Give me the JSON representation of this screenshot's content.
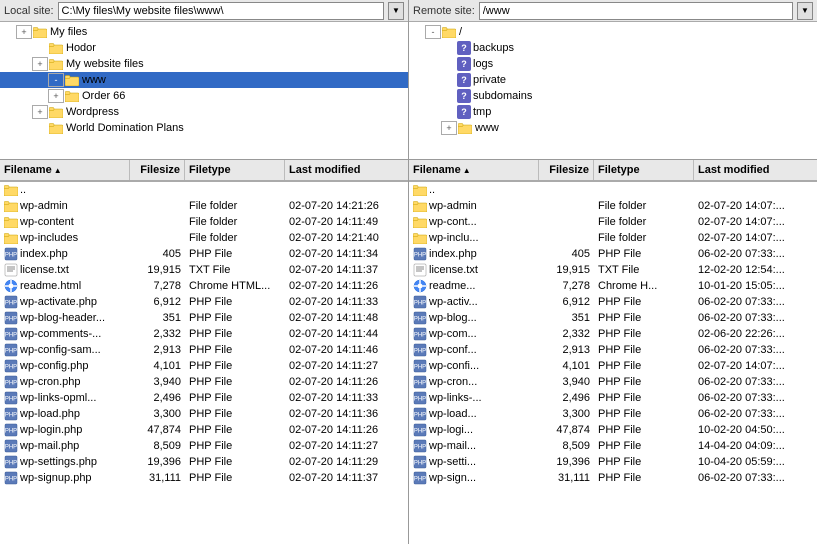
{
  "left_site": {
    "label": "Local site:",
    "path": "C:\\My files\\My website files\\www\\",
    "tree": [
      {
        "level": 1,
        "expand": "+",
        "name": "My files",
        "expanded": true
      },
      {
        "level": 2,
        "expand": null,
        "name": "Hodor"
      },
      {
        "level": 2,
        "expand": "+",
        "name": "My website files",
        "expanded": true
      },
      {
        "level": 3,
        "expand": "-",
        "name": "www",
        "active": true
      },
      {
        "level": 3,
        "expand": "+",
        "name": "Order 66"
      },
      {
        "level": 2,
        "expand": "+",
        "name": "Wordpress"
      },
      {
        "level": 2,
        "expand": null,
        "name": "World Domination Plans"
      }
    ],
    "columns": [
      "Filename",
      "Filesize",
      "Filetype",
      "Last modified"
    ],
    "files": [
      {
        "name": "..",
        "size": "",
        "type": "",
        "modified": ""
      },
      {
        "name": "wp-admin",
        "size": "",
        "type": "File folder",
        "modified": "02-07-20 14:21:26"
      },
      {
        "name": "wp-content",
        "size": "",
        "type": "File folder",
        "modified": "02-07-20 14:11:49"
      },
      {
        "name": "wp-includes",
        "size": "",
        "type": "File folder",
        "modified": "02-07-20 14:21:40"
      },
      {
        "name": "index.php",
        "size": "405",
        "type": "PHP File",
        "modified": "02-07-20 14:11:34"
      },
      {
        "name": "license.txt",
        "size": "19,915",
        "type": "TXT File",
        "modified": "02-07-20 14:11:37"
      },
      {
        "name": "readme.html",
        "size": "7,278",
        "type": "Chrome HTML...",
        "modified": "02-07-20 14:11:26"
      },
      {
        "name": "wp-activate.php",
        "size": "6,912",
        "type": "PHP File",
        "modified": "02-07-20 14:11:33"
      },
      {
        "name": "wp-blog-header...",
        "size": "351",
        "type": "PHP File",
        "modified": "02-07-20 14:11:48"
      },
      {
        "name": "wp-comments-...",
        "size": "2,332",
        "type": "PHP File",
        "modified": "02-07-20 14:11:44"
      },
      {
        "name": "wp-config-sam...",
        "size": "2,913",
        "type": "PHP File",
        "modified": "02-07-20 14:11:46"
      },
      {
        "name": "wp-config.php",
        "size": "4,101",
        "type": "PHP File",
        "modified": "02-07-20 14:11:27"
      },
      {
        "name": "wp-cron.php",
        "size": "3,940",
        "type": "PHP File",
        "modified": "02-07-20 14:11:26"
      },
      {
        "name": "wp-links-opml...",
        "size": "2,496",
        "type": "PHP File",
        "modified": "02-07-20 14:11:33"
      },
      {
        "name": "wp-load.php",
        "size": "3,300",
        "type": "PHP File",
        "modified": "02-07-20 14:11:36"
      },
      {
        "name": "wp-login.php",
        "size": "47,874",
        "type": "PHP File",
        "modified": "02-07-20 14:11:26"
      },
      {
        "name": "wp-mail.php",
        "size": "8,509",
        "type": "PHP File",
        "modified": "02-07-20 14:11:27"
      },
      {
        "name": "wp-settings.php",
        "size": "19,396",
        "type": "PHP File",
        "modified": "02-07-20 14:11:29"
      },
      {
        "name": "wp-signup.php",
        "size": "31,111",
        "type": "PHP File",
        "modified": "02-07-20 14:11:37"
      }
    ]
  },
  "right_site": {
    "label": "Remote site:",
    "path": "/www",
    "tree": [
      {
        "level": 1,
        "expand": "-",
        "name": "/",
        "expanded": true
      },
      {
        "level": 2,
        "q": true,
        "name": "backups"
      },
      {
        "level": 2,
        "q": true,
        "name": "logs"
      },
      {
        "level": 2,
        "q": true,
        "name": "private"
      },
      {
        "level": 2,
        "q": true,
        "name": "subdomains"
      },
      {
        "level": 2,
        "q": true,
        "name": "tmp"
      },
      {
        "level": 2,
        "expand": "+",
        "name": "www"
      }
    ],
    "columns": [
      "Filename",
      "Filesize",
      "Filetype",
      "Last modified"
    ],
    "files": [
      {
        "name": "..",
        "size": "",
        "type": "",
        "modified": ""
      },
      {
        "name": "wp-admin",
        "size": "",
        "type": "File folder",
        "modified": "02-07-20 14:07:..."
      },
      {
        "name": "wp-cont...",
        "size": "",
        "type": "File folder",
        "modified": "02-07-20 14:07:..."
      },
      {
        "name": "wp-inclu...",
        "size": "",
        "type": "File folder",
        "modified": "02-07-20 14:07:..."
      },
      {
        "name": "index.php",
        "size": "405",
        "type": "PHP File",
        "modified": "06-02-20 07:33:..."
      },
      {
        "name": "license.txt",
        "size": "19,915",
        "type": "TXT File",
        "modified": "12-02-20 12:54:..."
      },
      {
        "name": "readme...",
        "size": "7,278",
        "type": "Chrome H...",
        "modified": "10-01-20 15:05:..."
      },
      {
        "name": "wp-activ...",
        "size": "6,912",
        "type": "PHP File",
        "modified": "06-02-20 07:33:..."
      },
      {
        "name": "wp-blog...",
        "size": "351",
        "type": "PHP File",
        "modified": "06-02-20 07:33:..."
      },
      {
        "name": "wp-com...",
        "size": "2,332",
        "type": "PHP File",
        "modified": "02-06-20 22:26:..."
      },
      {
        "name": "wp-conf...",
        "size": "2,913",
        "type": "PHP File",
        "modified": "06-02-20 07:33:..."
      },
      {
        "name": "wp-confi...",
        "size": "4,101",
        "type": "PHP File",
        "modified": "02-07-20 14:07:..."
      },
      {
        "name": "wp-cron...",
        "size": "3,940",
        "type": "PHP File",
        "modified": "06-02-20 07:33:..."
      },
      {
        "name": "wp-links-...",
        "size": "2,496",
        "type": "PHP File",
        "modified": "06-02-20 07:33:..."
      },
      {
        "name": "wp-load...",
        "size": "3,300",
        "type": "PHP File",
        "modified": "06-02-20 07:33:..."
      },
      {
        "name": "wp-logi...",
        "size": "47,874",
        "type": "PHP File",
        "modified": "10-02-20 04:50:..."
      },
      {
        "name": "wp-mail...",
        "size": "8,509",
        "type": "PHP File",
        "modified": "14-04-20 04:09:..."
      },
      {
        "name": "wp-setti...",
        "size": "19,396",
        "type": "PHP File",
        "modified": "10-04-20 05:59:..."
      },
      {
        "name": "wp-sign...",
        "size": "31,111",
        "type": "PHP File",
        "modified": "06-02-20 07:33:..."
      }
    ]
  },
  "icons": {
    "folder_open": "📁",
    "folder": "📁",
    "php": "🔷",
    "txt": "📄",
    "html": "🌐",
    "parent": "↑",
    "expand_plus": "+",
    "expand_minus": "-"
  }
}
